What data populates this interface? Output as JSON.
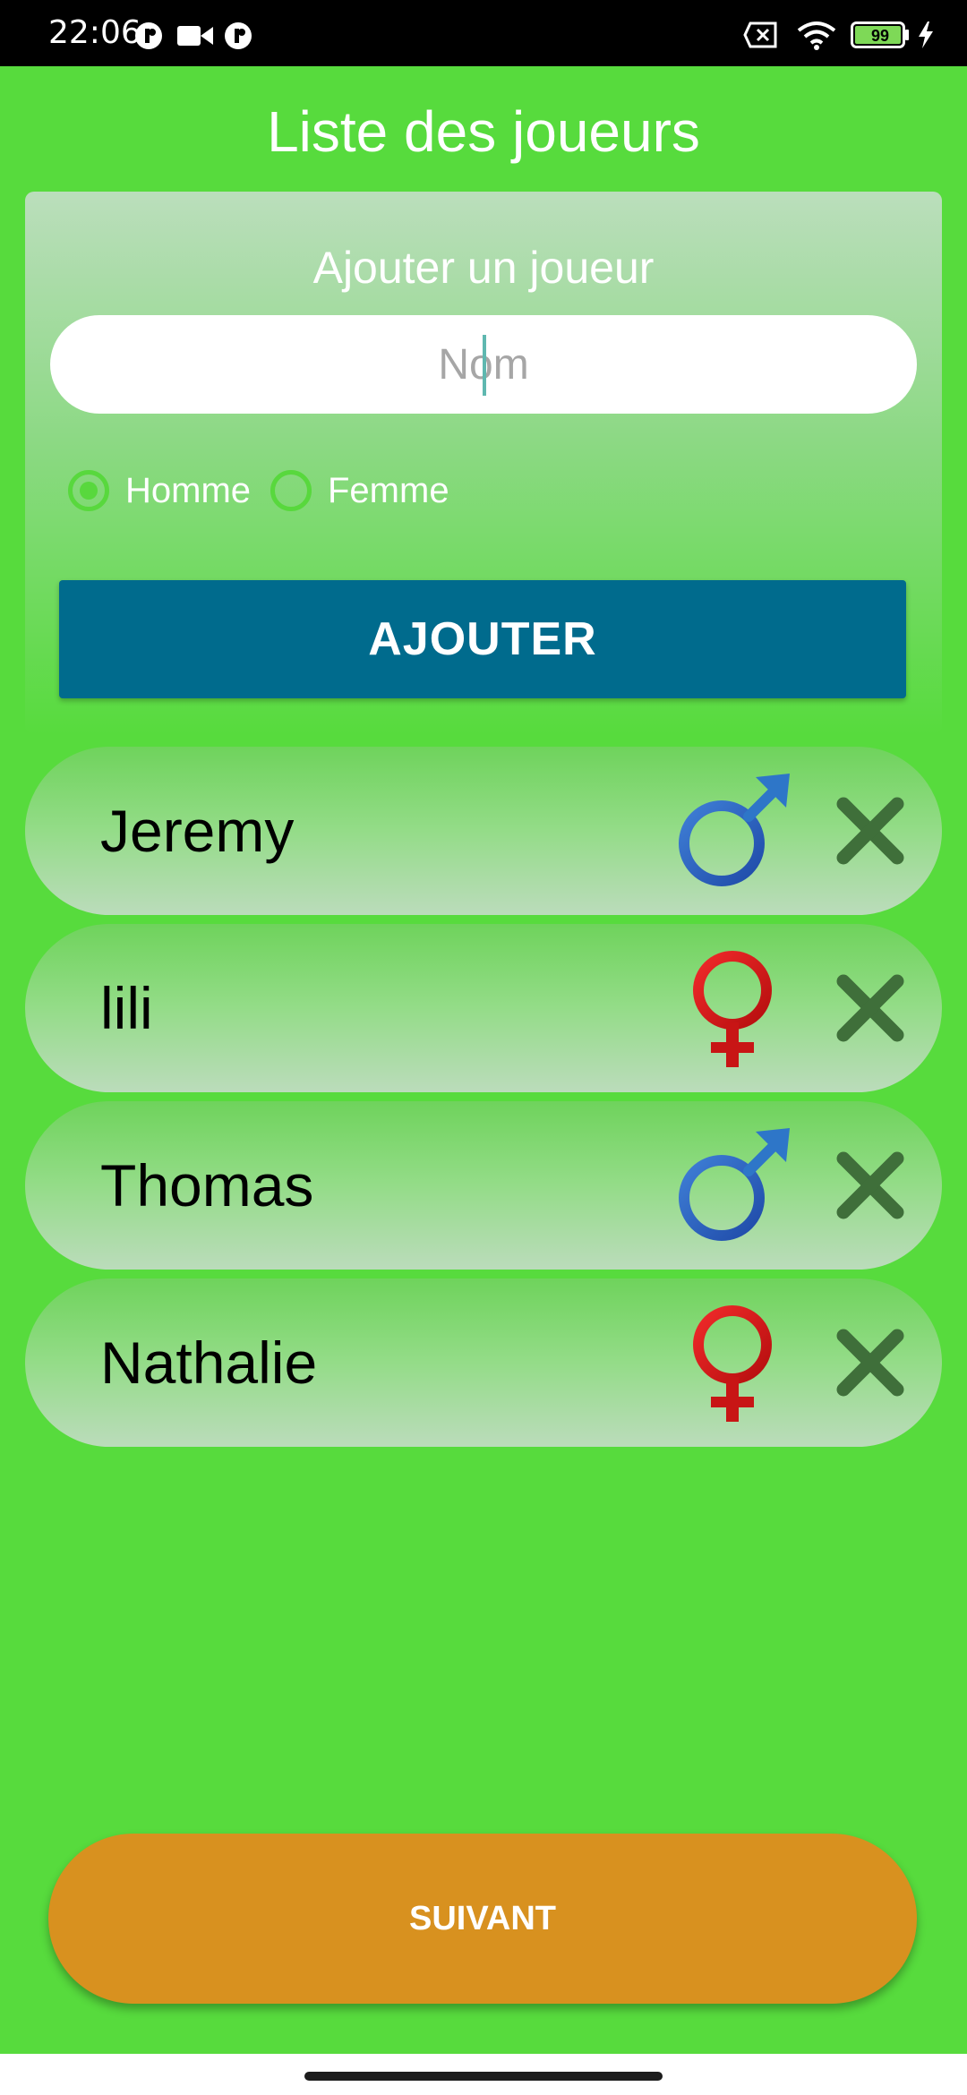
{
  "status_bar": {
    "time": "22:06",
    "battery_level": "99",
    "icons": [
      "app-notification-icon",
      "video-camera-icon",
      "app-notification-icon",
      "sim-off-icon",
      "wifi-icon",
      "battery-icon",
      "charging-icon"
    ]
  },
  "page_title": "Liste des joueurs",
  "add_player": {
    "heading": "Ajouter un joueur",
    "name_placeholder": "Nom",
    "name_value": "",
    "gender_options": [
      {
        "label": "Homme",
        "selected": true
      },
      {
        "label": "Femme",
        "selected": false
      }
    ],
    "add_button_label": "AJOUTER"
  },
  "players": [
    {
      "name": "Jeremy",
      "gender": "male",
      "gender_icon": "male-symbol-icon",
      "remove_icon": "close-icon"
    },
    {
      "name": "lili",
      "gender": "female",
      "gender_icon": "female-symbol-icon",
      "remove_icon": "close-icon"
    },
    {
      "name": "Thomas",
      "gender": "male",
      "gender_icon": "male-symbol-icon",
      "remove_icon": "close-icon"
    },
    {
      "name": "Nathalie",
      "gender": "female",
      "gender_icon": "female-symbol-icon",
      "remove_icon": "close-icon"
    }
  ],
  "next_button_label": "SUIVANT",
  "colors": {
    "background": "#57db3d",
    "add_button": "#006b8d",
    "next_button": "#d8911f",
    "male_symbol": "#2a5db8",
    "female_symbol": "#d41414",
    "remove_icon": "#3f6f3a"
  }
}
